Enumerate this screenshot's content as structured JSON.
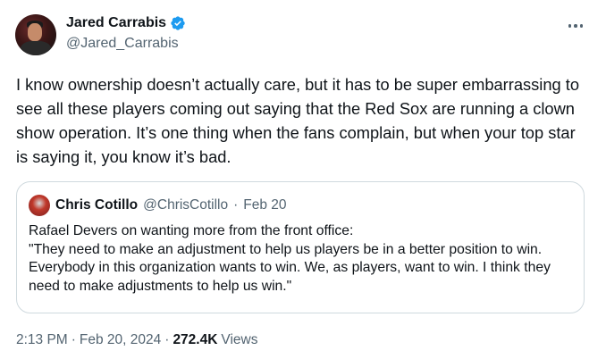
{
  "author": {
    "display_name": "Jared Carrabis",
    "handle": "@Jared_Carrabis",
    "verified": true
  },
  "tweet": {
    "text": "I know ownership doesn’t actually care, but it has to be super embarrassing to see all these players coming out saying that the Red Sox are running a clown show operation. It’s one thing when the fans complain, but when your top star is saying it, you know it’s bad."
  },
  "quoted_tweet": {
    "display_name": "Chris Cotillo",
    "handle": "@ChrisCotillo",
    "separator": "·",
    "date": "Feb 20",
    "line1": "Rafael Devers on wanting more from the front office:",
    "line2": "\"They need to make an adjustment to help us players be in a better position to win. Everybody in this organization wants to win. We, as players, want to win. I think they need to make adjustments to help us win.\""
  },
  "meta": {
    "time": "2:13 PM",
    "separator": "·",
    "date": "Feb 20, 2024",
    "views_count": "272.4K",
    "views_label": "Views"
  },
  "icons": {
    "more": "more-horizontal-icon",
    "verified": "verified-badge-icon"
  },
  "colors": {
    "verified_blue": "#1d9bf0",
    "secondary_text": "#536471",
    "border": "#cfd9de"
  }
}
